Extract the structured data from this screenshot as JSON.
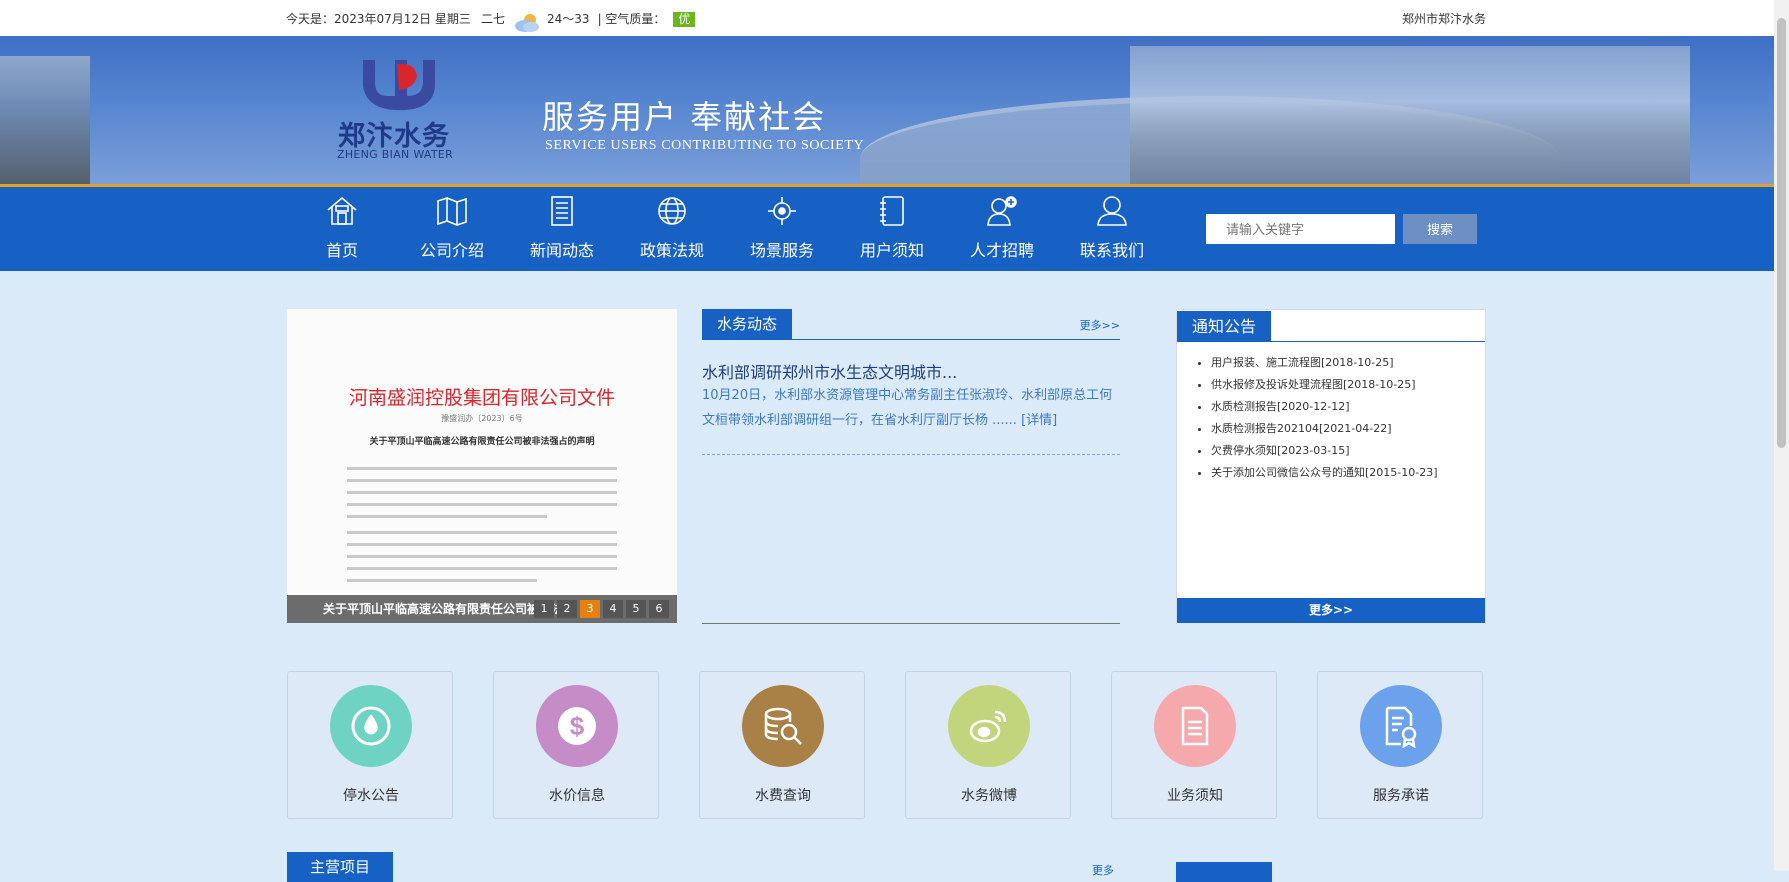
{
  "topbar": {
    "date_text": "今天是：2023年07月12日 星期三",
    "district": "二七",
    "temperature": "24～33",
    "air_quality_label": "| 空气质量：",
    "air_quality_value": "优",
    "company_name": "郑州市郑汴水务"
  },
  "banner": {
    "logo_cn": "郑汴水务",
    "logo_en": "ZHENG BIAN WATER",
    "slogan_cn": "服务用户  奉献社会",
    "slogan_en": "SERVICE USERS CONTRIBUTING TO SOCIETY"
  },
  "nav": {
    "items": [
      {
        "label": "首页",
        "icon": "home-icon"
      },
      {
        "label": "公司介绍",
        "icon": "map-icon"
      },
      {
        "label": "新闻动态",
        "icon": "document-icon"
      },
      {
        "label": "政策法规",
        "icon": "globe-icon"
      },
      {
        "label": "场景服务",
        "icon": "target-icon"
      },
      {
        "label": "用户须知",
        "icon": "notebook-icon"
      },
      {
        "label": "人才招聘",
        "icon": "add-user-icon"
      },
      {
        "label": "联系我们",
        "icon": "user-icon"
      }
    ],
    "search_placeholder": "请输入关键字",
    "search_button": "搜索"
  },
  "carousel": {
    "doc_title": "河南盛润控股集团有限公司文件",
    "doc_number": "豫盛润办〔2023〕6号",
    "doc_heading": "关于平顶山平临高速公路有限责任公司被非法强占的声明",
    "caption": "关于平顶山平临高速公路有限责任公司被非法强占的声明",
    "pages": [
      "1",
      "2",
      "3",
      "4",
      "5",
      "6"
    ],
    "active_page": "3"
  },
  "news": {
    "tab_label": "水务动态",
    "more": "更多>>",
    "headline": "水利部调研郑州市水生态文明城市...",
    "summary": "10月20日，水利部水资源管理中心常务副主任张淑玲、水利部原总工何文桓带领水利部调研组一行，在省水利厅副厅长杨 ......",
    "detail": "[详情]"
  },
  "notice": {
    "tab_label": "通知公告",
    "items": [
      "用户报装、施工流程图[2018-10-25]",
      "供水报修及投诉处理流程图[2018-10-25]",
      "水质检测报告[2020-12-12]",
      "水质检测报告202104[2021-04-22]",
      "欠费停水须知[2023-03-15]",
      "关于添加公司微信公众号的通知[2015-10-23]"
    ],
    "more": "更多>>"
  },
  "services": [
    {
      "label": "停水公告",
      "icon": "water-drop-icon",
      "color": "#6fd3c4"
    },
    {
      "label": "水价信息",
      "icon": "dollar-icon",
      "color": "#c58cc8"
    },
    {
      "label": "水费查询",
      "icon": "database-search-icon",
      "color": "#a98045"
    },
    {
      "label": "水务微博",
      "icon": "weibo-icon",
      "color": "#c3d57c"
    },
    {
      "label": "业务须知",
      "icon": "file-icon",
      "color": "#f6a9ad"
    },
    {
      "label": "服务承诺",
      "icon": "certificate-icon",
      "color": "#6ca2ec"
    }
  ],
  "bottom": {
    "tab_label": "主营项目",
    "more": "更多"
  },
  "colors": {
    "nav_blue": "#1761c5",
    "accent_orange": "#e7810e",
    "aq_green": "#6cb81c",
    "page_bg": "#dbeaf8"
  }
}
